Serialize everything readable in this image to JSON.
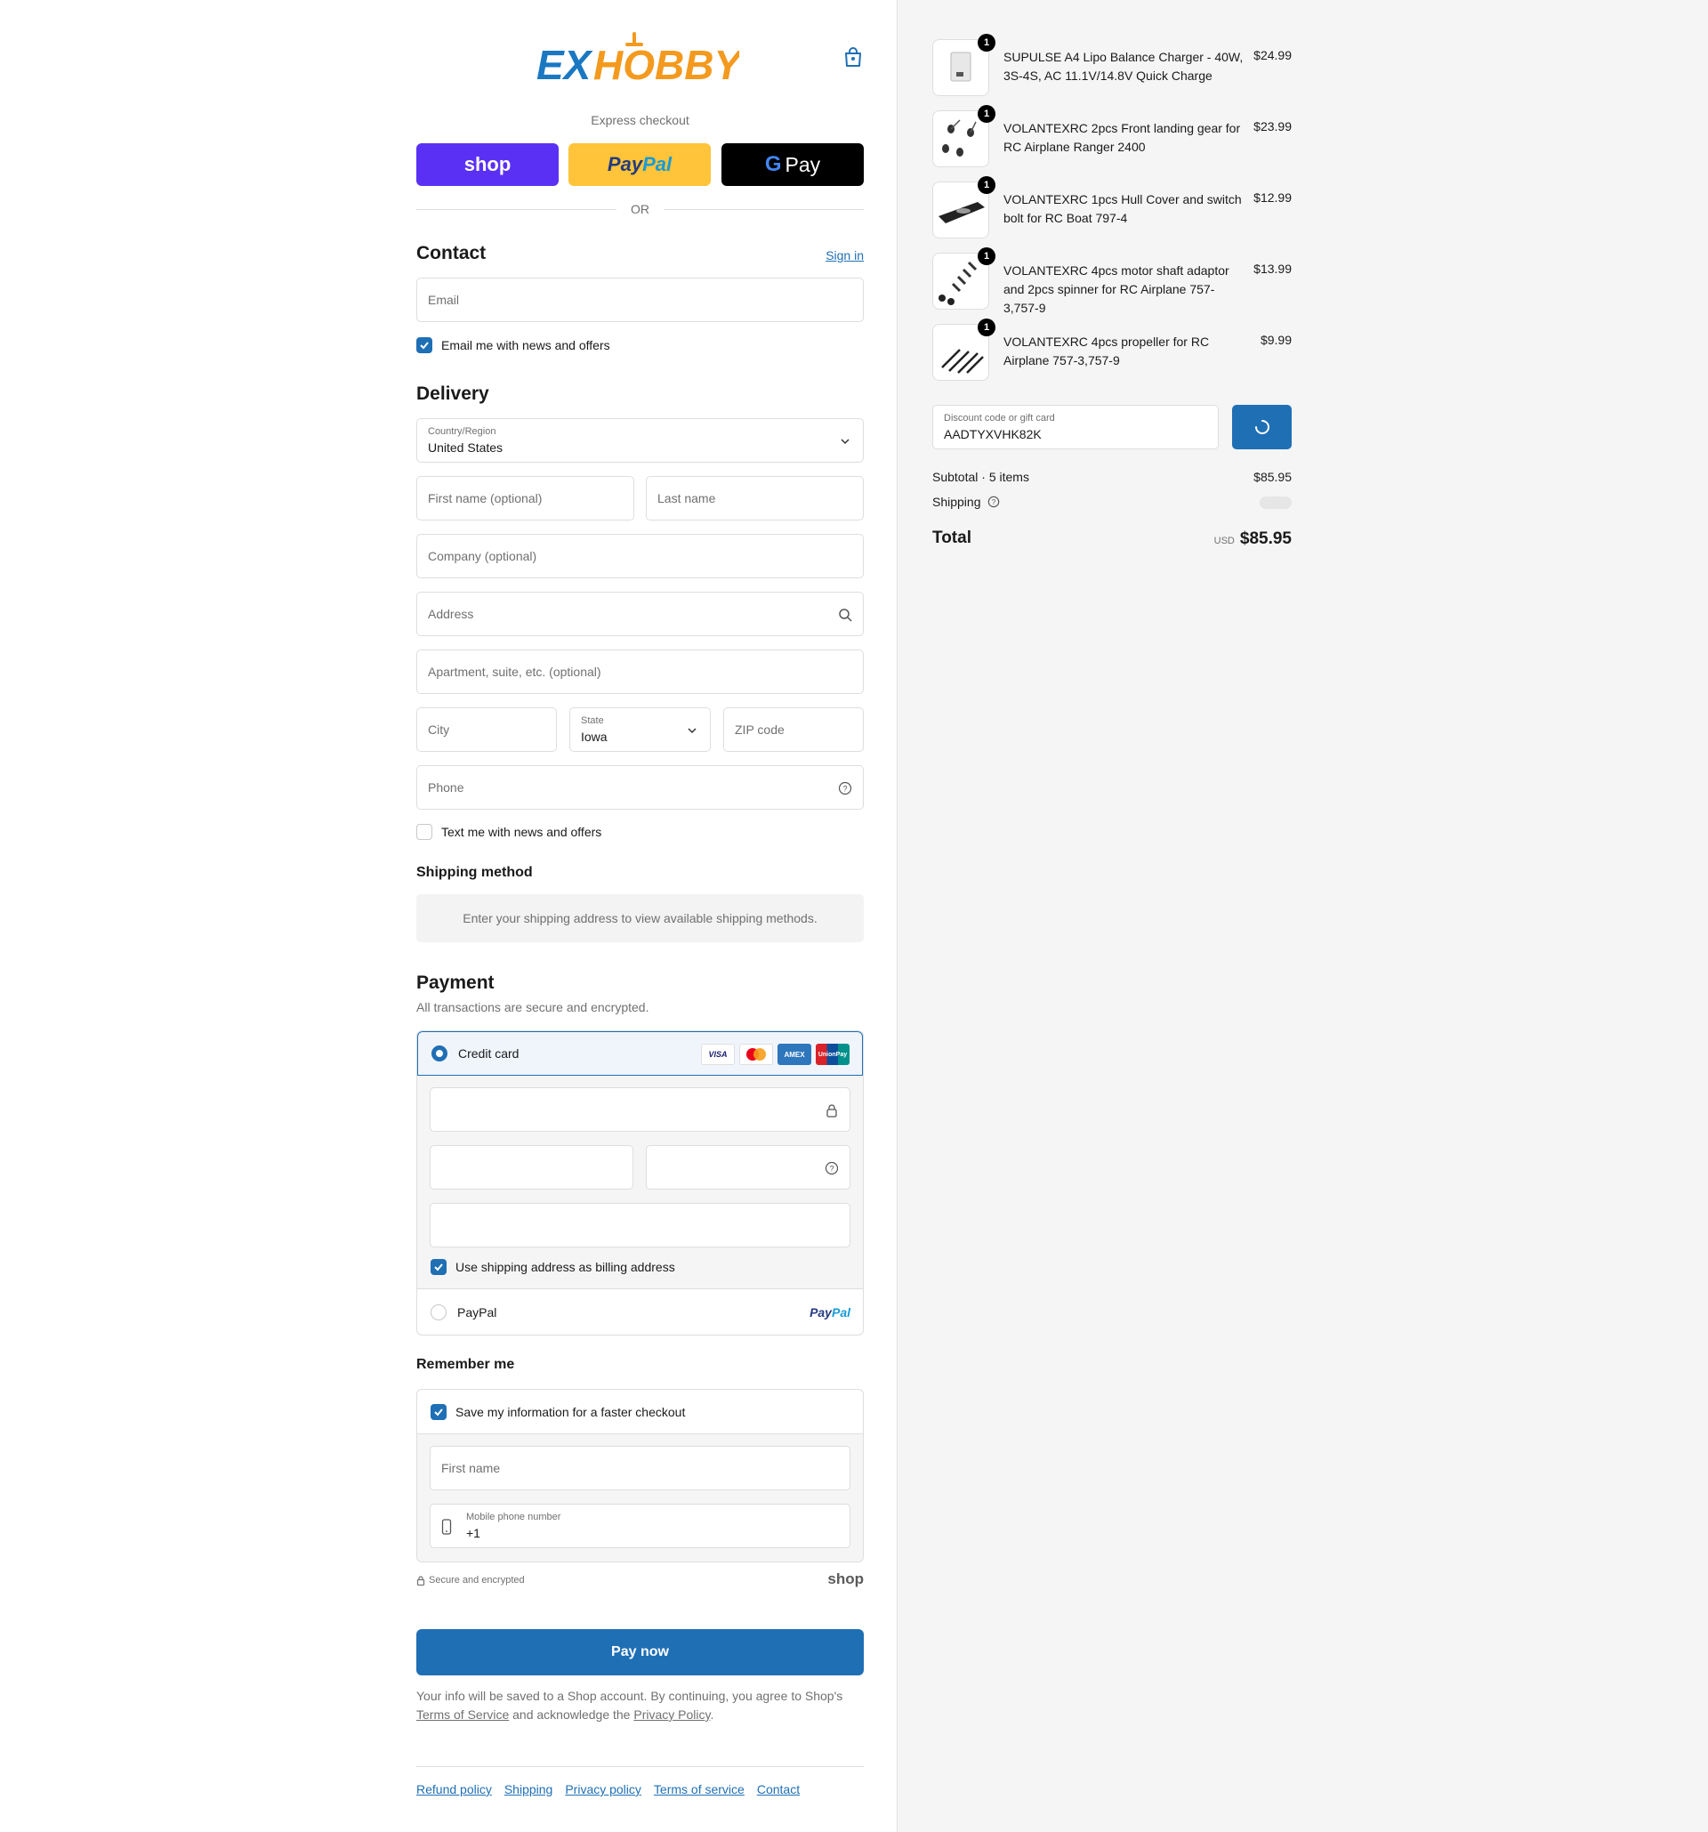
{
  "header": {
    "logo_text_ex": "EX",
    "logo_text_hobby": "HOBBY",
    "express_checkout": "Express checkout",
    "shop_pay": "shop",
    "paypal_pay": "Pay",
    "paypal_pal": "Pal",
    "gpay": "Pay",
    "gpay_g": "G",
    "or": "OR"
  },
  "contact": {
    "title": "Contact",
    "sign_in": "Sign in",
    "email_placeholder": "Email",
    "email_news": "Email me with news and offers"
  },
  "delivery": {
    "title": "Delivery",
    "country_label": "Country/Region",
    "country_value": "United States",
    "first_name": "First name (optional)",
    "last_name": "Last name",
    "company": "Company (optional)",
    "address": "Address",
    "apartment": "Apartment, suite, etc. (optional)",
    "city": "City",
    "state_label": "State",
    "state_value": "Iowa",
    "zip": "ZIP code",
    "phone": "Phone",
    "text_news": "Text me with news and offers"
  },
  "shipping": {
    "title": "Shipping method",
    "message": "Enter your shipping address to view available shipping methods."
  },
  "payment": {
    "title": "Payment",
    "subtitle": "All transactions are secure and encrypted.",
    "credit_card": "Credit card",
    "cards": [
      "VISA",
      "AMEX",
      "UnionPay"
    ],
    "use_shipping": "Use shipping address as billing address",
    "paypal": "PayPal",
    "paypal_logo_pay": "Pay",
    "paypal_logo_pal": "Pal"
  },
  "remember": {
    "title": "Remember me",
    "save_info": "Save my information for a faster checkout",
    "first_name": "First name",
    "mobile_label": "Mobile phone number",
    "mobile_value": "+1",
    "secure": "Secure and encrypted",
    "shop_mark": "shop"
  },
  "actions": {
    "pay_now": "Pay now",
    "legal_1": "Your info will be saved to a Shop account. By continuing, you agree to Shop's",
    "terms": "Terms of Service",
    "legal_2": "and acknowledge the",
    "privacy": "Privacy Policy",
    "legal_3": "."
  },
  "footer": {
    "links": [
      "Refund policy",
      "Shipping",
      "Privacy policy",
      "Terms of service",
      "Contact"
    ]
  },
  "order": {
    "items": [
      {
        "qty": "1",
        "name": "SUPULSE A4 Lipo Balance Charger - 40W, 3S-4S, AC 11.1V/14.8V Quick Charge",
        "price": "$24.99"
      },
      {
        "qty": "1",
        "name": "VOLANTEXRC 2pcs Front landing gear for RC Airplane Ranger 2400",
        "price": "$23.99"
      },
      {
        "qty": "1",
        "name": "VOLANTEXRC 1pcs Hull Cover and switch bolt for RC Boat 797-4",
        "price": "$12.99"
      },
      {
        "qty": "1",
        "name": "VOLANTEXRC 4pcs motor shaft adaptor and 2pcs spinner for RC Airplane 757-3,757-9",
        "price": "$13.99"
      },
      {
        "qty": "1",
        "name": "VOLANTEXRC 4pcs propeller for RC Airplane 757-3,757-9",
        "price": "$9.99"
      }
    ],
    "discount_label": "Discount code or gift card",
    "discount_value": "AADTYXVHK82K",
    "subtotal_label": "Subtotal · 5 items",
    "subtotal_value": "$85.95",
    "shipping_label": "Shipping",
    "total_label": "Total",
    "currency": "USD",
    "total_value": "$85.95"
  },
  "colors": {
    "accent": "#1f6fb5",
    "shop_purple": "#5a31f4",
    "paypal_yellow": "#ffc439",
    "logo_blue": "#1a78c2",
    "logo_orange": "#f39a1e"
  }
}
